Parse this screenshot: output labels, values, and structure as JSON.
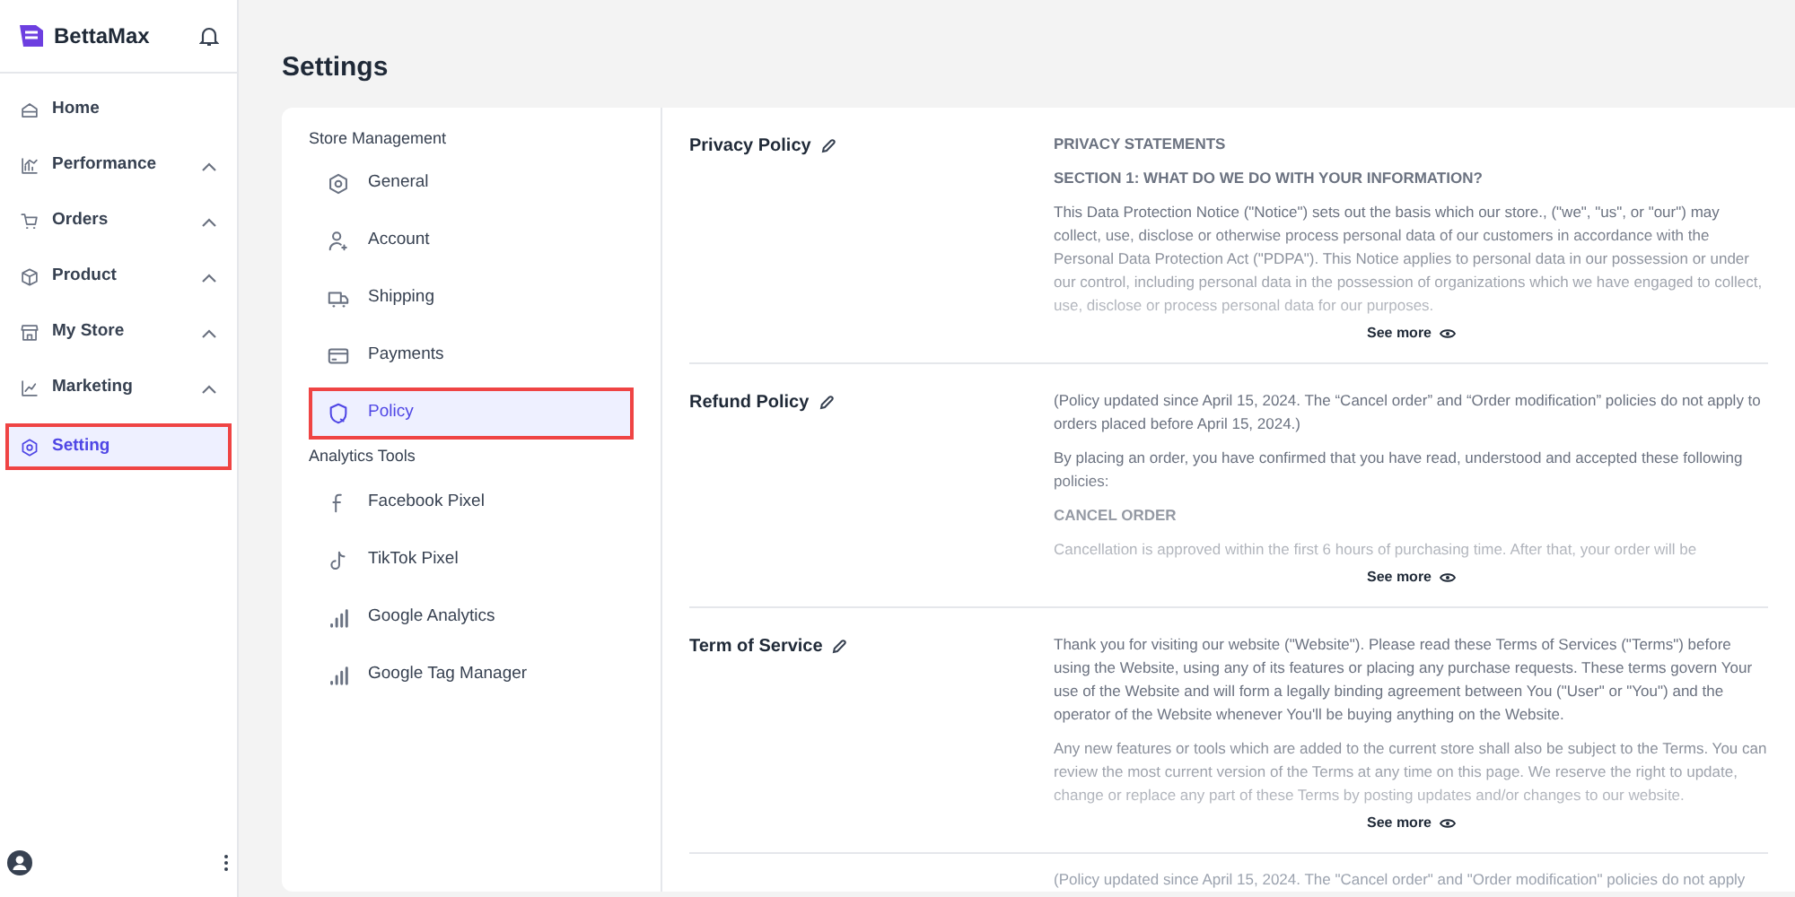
{
  "brand": {
    "name": "BettaMax"
  },
  "nav": [
    {
      "label": "Home",
      "kind": "link",
      "selected": false
    },
    {
      "label": "Performance",
      "kind": "group",
      "selected": false
    },
    {
      "label": "Orders",
      "kind": "group",
      "selected": false
    },
    {
      "label": "Product",
      "kind": "group",
      "selected": false
    },
    {
      "label": "My Store",
      "kind": "group",
      "selected": false
    },
    {
      "label": "Marketing",
      "kind": "group",
      "selected": false
    },
    {
      "label": "Setting",
      "kind": "link",
      "selected": true
    }
  ],
  "page_title": "Settings",
  "settings_menu": [
    {
      "title": "Store Management",
      "items": [
        {
          "label": "General",
          "selected": false
        },
        {
          "label": "Account",
          "selected": false
        },
        {
          "label": "Shipping",
          "selected": false
        },
        {
          "label": "Payments",
          "selected": false
        },
        {
          "label": "Policy",
          "selected": true
        }
      ]
    },
    {
      "title": "Analytics Tools",
      "items": [
        {
          "label": "Facebook Pixel",
          "selected": false
        },
        {
          "label": "TikTok Pixel",
          "selected": false
        },
        {
          "label": "Google Analytics",
          "selected": false
        },
        {
          "label": "Google Tag Manager",
          "selected": false
        }
      ]
    }
  ],
  "policies": [
    {
      "title": "Privacy Policy",
      "see_more": "See more",
      "blocks": [
        {
          "kind": "heading",
          "text": "PRIVACY STATEMENTS"
        },
        {
          "kind": "heading",
          "text": "SECTION 1: WHAT DO WE DO WITH YOUR INFORMATION?"
        },
        {
          "kind": "paragraph",
          "text": "This Data Protection Notice (\"Notice\") sets out the basis which our store., (\"we\", \"us\", or \"our\") may collect, use, disclose or otherwise process personal data of our customers in accordance with the Personal Data Protection Act (\"PDPA\"). This Notice applies to personal data in our possession or under our control, including personal data in the possession of organizations which we have engaged to collect, use, disclose or process personal data for our purposes."
        }
      ]
    },
    {
      "title": "Refund Policy",
      "see_more": "See more",
      "blocks": [
        {
          "kind": "paragraph",
          "text": "(Policy updated since April 15, 2024. The “Cancel order” and “Order modification” policies do not apply to orders placed before April 15, 2024.)"
        },
        {
          "kind": "paragraph",
          "text": "By placing an order, you have confirmed that you have read, understood and accepted these following policies:"
        },
        {
          "kind": "heading",
          "text": "CANCEL ORDER"
        },
        {
          "kind": "paragraph",
          "text": "Cancellation is approved within the first 6 hours of purchasing time. After that, your order will be"
        }
      ]
    },
    {
      "title": "Term of Service",
      "see_more": "See more",
      "blocks": [
        {
          "kind": "paragraph",
          "text": "Thank you for visiting our website (\"Website\"). Please read these Terms of Services (\"Terms\") before using the Website, using any of its features or placing any purchase requests. These terms govern Your use of the Website and will form a legally binding agreement between You (\"User\" or \"You\") and the operator of the Website whenever You'll be buying anything on the Website."
        },
        {
          "kind": "paragraph",
          "text": "Any new features or tools which are added to the current store shall also be subject to the Terms. You can review the most current version of the Terms at any time on this page. We reserve the right to update, change or replace any part of these Terms by posting updates and/or changes to our website."
        }
      ]
    },
    {
      "blocks": [
        {
          "kind": "paragraph",
          "text": "(Policy updated since April 15, 2024. The \"Cancel order\" and \"Order modification\" policies do not apply"
        }
      ]
    }
  ]
}
